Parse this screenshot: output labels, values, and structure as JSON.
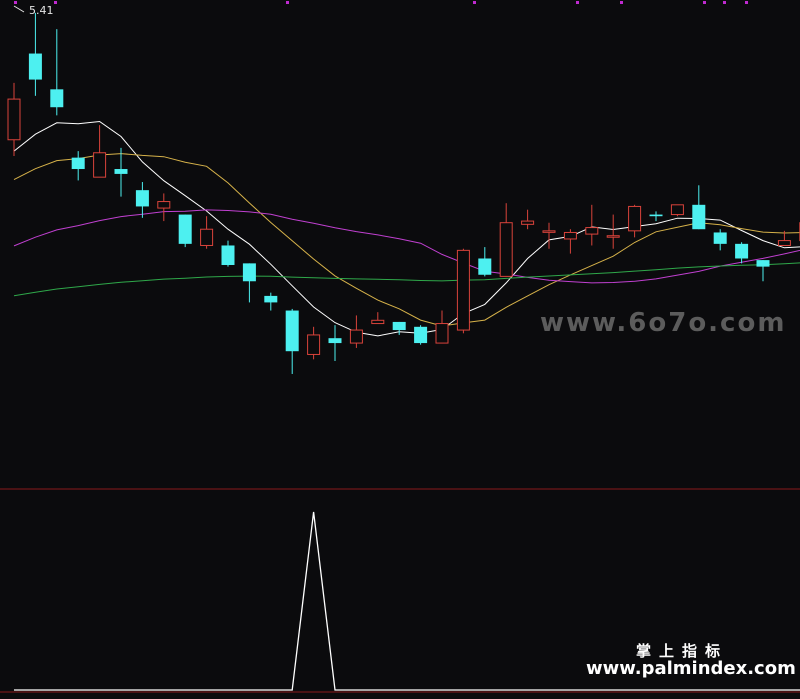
{
  "price_label": "5.41",
  "watermark_site": "www.6o7o.com",
  "brand_cn": "掌上指标",
  "brand_url": "www.palmindex.com",
  "colors": {
    "up": "#d9433b",
    "down": "#4df0f0",
    "ma_white": "#ffffff",
    "ma_yellow": "#d6b24a",
    "ma_magenta": "#c040d0",
    "ma_green": "#2fa84a",
    "separator": "#8a1a1a",
    "indicator": "#ffffff"
  },
  "chart_data": [
    {
      "type": "candlestick",
      "title": "",
      "annotations": [
        "5.41"
      ],
      "ylim": [
        3.0,
        5.41
      ],
      "candles": [
        {
          "o": 4.6,
          "c": 4.85,
          "h": 4.95,
          "l": 4.5
        },
        {
          "o": 5.13,
          "c": 4.97,
          "h": 5.38,
          "l": 4.87
        },
        {
          "o": 4.91,
          "c": 4.8,
          "h": 5.28,
          "l": 4.75
        },
        {
          "o": 4.49,
          "c": 4.42,
          "h": 4.53,
          "l": 4.35
        },
        {
          "o": 4.37,
          "c": 4.52,
          "h": 4.69,
          "l": 4.37
        },
        {
          "o": 4.42,
          "c": 4.39,
          "h": 4.55,
          "l": 4.25
        },
        {
          "o": 4.29,
          "c": 4.19,
          "h": 4.34,
          "l": 4.12
        },
        {
          "o": 4.18,
          "c": 4.22,
          "h": 4.27,
          "l": 4.1
        },
        {
          "o": 4.14,
          "c": 3.96,
          "h": 4.14,
          "l": 3.94
        },
        {
          "o": 3.95,
          "c": 4.05,
          "h": 4.13,
          "l": 3.93
        },
        {
          "o": 3.95,
          "c": 3.83,
          "h": 3.98,
          "l": 3.82
        },
        {
          "o": 3.84,
          "c": 3.73,
          "h": 3.84,
          "l": 3.6
        },
        {
          "o": 3.64,
          "c": 3.6,
          "h": 3.66,
          "l": 3.55
        },
        {
          "o": 3.55,
          "c": 3.3,
          "h": 3.56,
          "l": 3.16
        },
        {
          "o": 3.28,
          "c": 3.4,
          "h": 3.45,
          "l": 3.25
        },
        {
          "o": 3.38,
          "c": 3.35,
          "h": 3.46,
          "l": 3.24
        },
        {
          "o": 3.35,
          "c": 3.43,
          "h": 3.52,
          "l": 3.32
        },
        {
          "o": 3.47,
          "c": 3.49,
          "h": 3.54,
          "l": 3.47
        },
        {
          "o": 3.48,
          "c": 3.43,
          "h": 3.48,
          "l": 3.4
        },
        {
          "o": 3.45,
          "c": 3.35,
          "h": 3.46,
          "l": 3.34
        },
        {
          "o": 3.35,
          "c": 3.47,
          "h": 3.55,
          "l": 3.35
        },
        {
          "o": 3.43,
          "c": 3.92,
          "h": 3.93,
          "l": 3.41
        },
        {
          "o": 3.87,
          "c": 3.77,
          "h": 3.94,
          "l": 3.76
        },
        {
          "o": 3.76,
          "c": 4.09,
          "h": 4.21,
          "l": 3.76
        },
        {
          "o": 4.08,
          "c": 4.1,
          "h": 4.17,
          "l": 4.05
        },
        {
          "o": 4.04,
          "c": 4.04,
          "h": 4.09,
          "l": 3.93
        },
        {
          "o": 3.99,
          "c": 4.03,
          "h": 4.05,
          "l": 3.9
        },
        {
          "o": 4.02,
          "c": 4.06,
          "h": 4.2,
          "l": 3.95
        },
        {
          "o": 4.01,
          "c": 4.01,
          "h": 4.14,
          "l": 3.93
        },
        {
          "o": 4.04,
          "c": 4.19,
          "h": 4.2,
          "l": 4.0
        },
        {
          "o": 4.14,
          "c": 4.13,
          "h": 4.16,
          "l": 4.1
        },
        {
          "o": 4.14,
          "c": 4.2,
          "h": 4.2,
          "l": 4.13
        },
        {
          "o": 4.2,
          "c": 4.05,
          "h": 4.32,
          "l": 4.05
        },
        {
          "o": 4.03,
          "c": 3.96,
          "h": 4.05,
          "l": 3.92
        },
        {
          "o": 3.96,
          "c": 3.87,
          "h": 3.97,
          "l": 3.84
        },
        {
          "o": 3.86,
          "c": 3.82,
          "h": 3.86,
          "l": 3.73
        },
        {
          "o": 3.95,
          "c": 3.98,
          "h": 4.04,
          "l": 3.95
        },
        {
          "o": 3.98,
          "c": 4.09,
          "h": 4.16,
          "l": 3.97
        },
        {
          "o": 4.1,
          "c": 4.1,
          "h": 4.14,
          "l": 4.06
        }
      ]
    },
    {
      "type": "line",
      "title": "",
      "ylim": [
        0,
        1
      ],
      "x": [
        0,
        13,
        14,
        15,
        38
      ],
      "values": [
        0,
        0,
        1,
        0,
        0
      ]
    }
  ]
}
